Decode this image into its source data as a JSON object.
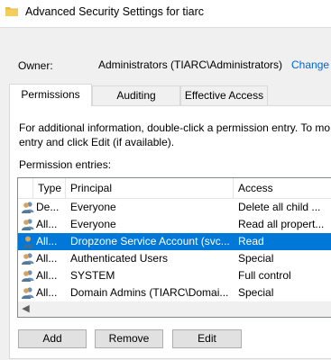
{
  "window": {
    "title": "Advanced Security Settings for tiarc"
  },
  "owner": {
    "label": "Owner:",
    "value": "Administrators (TIARC\\Administrators)",
    "change_link": "Change"
  },
  "tabs": [
    {
      "label": "Permissions",
      "active": true
    },
    {
      "label": "Auditing",
      "active": false
    },
    {
      "label": "Effective Access",
      "active": false
    }
  ],
  "permissions": {
    "info_text": "For additional information, double-click a permission entry. To mo\nentry and click Edit (if available).",
    "entries_label": "Permission entries:",
    "columns": [
      "Type",
      "Principal",
      "Access"
    ],
    "rows": [
      {
        "type": "De...",
        "principal": "Everyone",
        "access": "Delete all child ...",
        "selected": false
      },
      {
        "type": "All...",
        "principal": "Everyone",
        "access": "Read all propert...",
        "selected": false
      },
      {
        "type": "All...",
        "principal": "Dropzone Service Account (svc...",
        "access": "Read",
        "selected": true
      },
      {
        "type": "All...",
        "principal": "Authenticated Users",
        "access": "Special",
        "selected": false
      },
      {
        "type": "All...",
        "principal": "SYSTEM",
        "access": "Full control",
        "selected": false
      },
      {
        "type": "All...",
        "principal": "Domain Admins (TIARC\\Domai...",
        "access": "Special",
        "selected": false
      }
    ]
  },
  "buttons": {
    "add": "Add",
    "remove": "Remove",
    "edit": "Edit"
  },
  "colors": {
    "selection": "#0078d7",
    "link": "#0066cc",
    "folder": "#e8b84a"
  }
}
